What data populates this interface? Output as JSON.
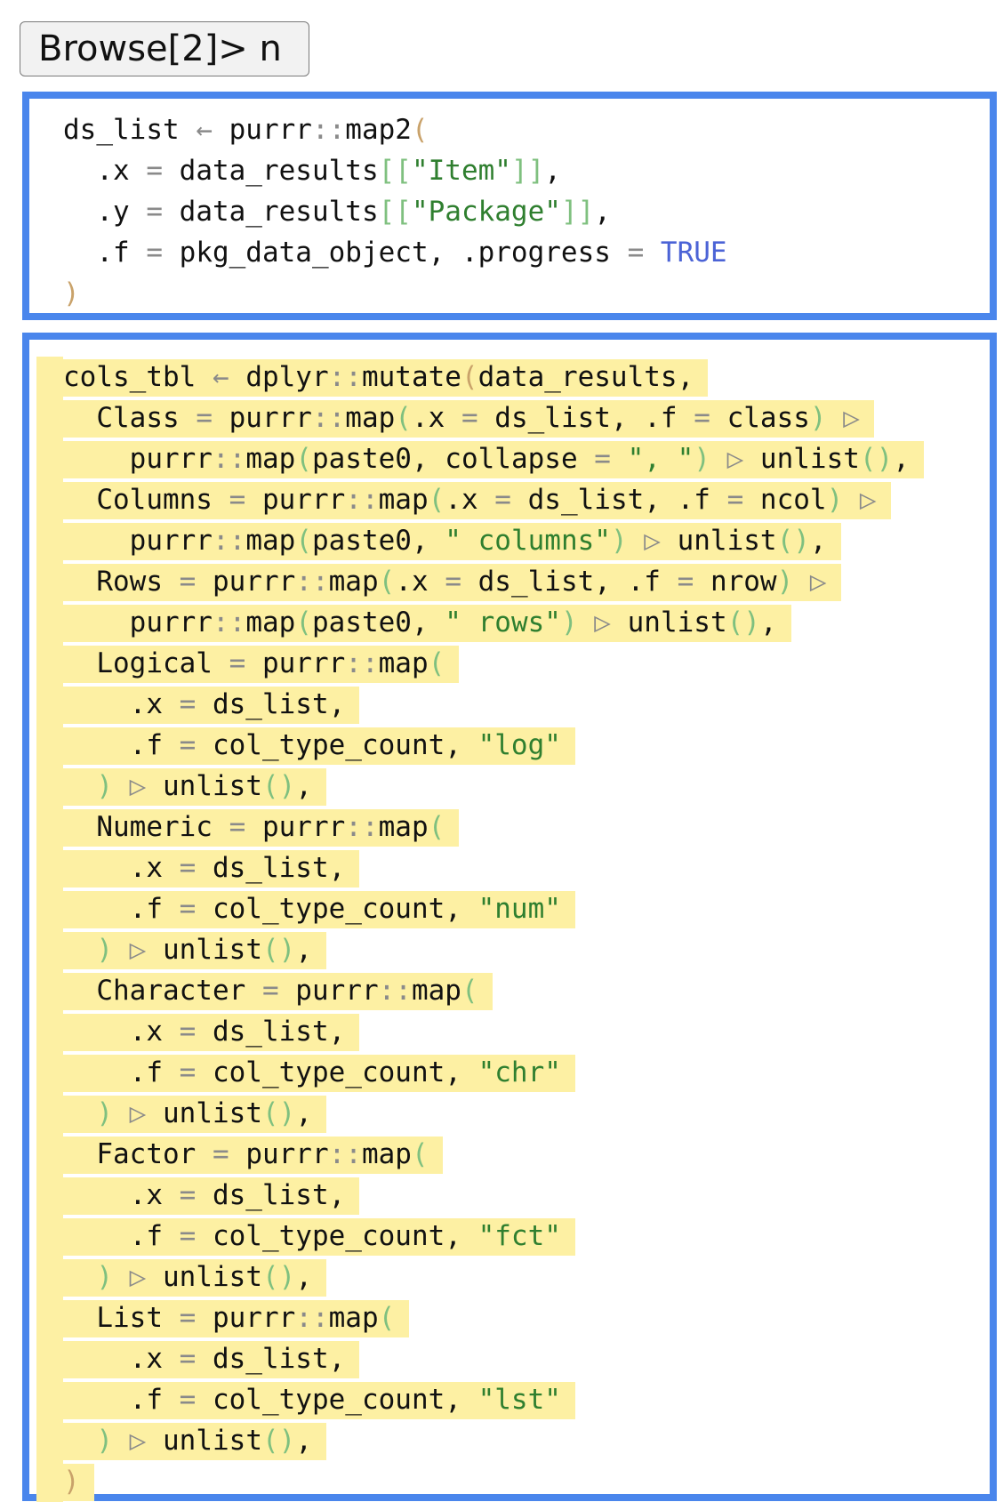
{
  "prompt": {
    "text": "Browse[2]> n"
  },
  "code_blocks": [
    {
      "highlighted": false,
      "lines": [
        [
          [
            "id",
            "ds_list "
          ],
          [
            "op",
            "← "
          ],
          [
            "id",
            "purrr"
          ],
          [
            "op",
            "::"
          ],
          [
            "id",
            "map2"
          ],
          [
            "br",
            "("
          ]
        ],
        [
          [
            "id",
            "  .x "
          ],
          [
            "op",
            "= "
          ],
          [
            "id",
            "data_results"
          ],
          [
            "br2",
            "[["
          ],
          [
            "str",
            "\"Item\""
          ],
          [
            "br2",
            "]]"
          ],
          [
            "id",
            ","
          ]
        ],
        [
          [
            "id",
            "  .y "
          ],
          [
            "op",
            "= "
          ],
          [
            "id",
            "data_results"
          ],
          [
            "br2",
            "[["
          ],
          [
            "str",
            "\"Package\""
          ],
          [
            "br2",
            "]]"
          ],
          [
            "id",
            ","
          ]
        ],
        [
          [
            "id",
            "  .f "
          ],
          [
            "op",
            "= "
          ],
          [
            "id",
            "pkg_data_object, .progress "
          ],
          [
            "op",
            "= "
          ],
          [
            "bool",
            "TRUE"
          ]
        ],
        [
          [
            "br",
            ")"
          ]
        ]
      ]
    },
    {
      "highlighted": true,
      "lines": [
        [
          [
            "id",
            "cols_tbl "
          ],
          [
            "op",
            "← "
          ],
          [
            "id",
            "dplyr"
          ],
          [
            "op",
            "::"
          ],
          [
            "id",
            "mutate"
          ],
          [
            "br",
            "("
          ],
          [
            "id",
            "data_results,"
          ]
        ],
        [
          [
            "id",
            "  Class "
          ],
          [
            "op",
            "= "
          ],
          [
            "id",
            "purrr"
          ],
          [
            "op",
            "::"
          ],
          [
            "id",
            "map"
          ],
          [
            "br2",
            "("
          ],
          [
            "id",
            ".x "
          ],
          [
            "op",
            "= "
          ],
          [
            "id",
            "ds_list, .f "
          ],
          [
            "op",
            "= "
          ],
          [
            "id",
            "class"
          ],
          [
            "br2",
            ")"
          ],
          [
            "op",
            " ▷"
          ]
        ],
        [
          [
            "id",
            "    purrr"
          ],
          [
            "op",
            "::"
          ],
          [
            "id",
            "map"
          ],
          [
            "br2",
            "("
          ],
          [
            "id",
            "paste0, collapse "
          ],
          [
            "op",
            "= "
          ],
          [
            "str",
            "\", \""
          ],
          [
            "br2",
            ")"
          ],
          [
            "op",
            " ▷ "
          ],
          [
            "id",
            "unlist"
          ],
          [
            "br2",
            "()"
          ],
          [
            "id",
            ","
          ]
        ],
        [
          [
            "id",
            "  Columns "
          ],
          [
            "op",
            "= "
          ],
          [
            "id",
            "purrr"
          ],
          [
            "op",
            "::"
          ],
          [
            "id",
            "map"
          ],
          [
            "br2",
            "("
          ],
          [
            "id",
            ".x "
          ],
          [
            "op",
            "= "
          ],
          [
            "id",
            "ds_list, .f "
          ],
          [
            "op",
            "= "
          ],
          [
            "id",
            "ncol"
          ],
          [
            "br2",
            ")"
          ],
          [
            "op",
            " ▷"
          ]
        ],
        [
          [
            "id",
            "    purrr"
          ],
          [
            "op",
            "::"
          ],
          [
            "id",
            "map"
          ],
          [
            "br2",
            "("
          ],
          [
            "id",
            "paste0, "
          ],
          [
            "str",
            "\" columns\""
          ],
          [
            "br2",
            ")"
          ],
          [
            "op",
            " ▷ "
          ],
          [
            "id",
            "unlist"
          ],
          [
            "br2",
            "()"
          ],
          [
            "id",
            ","
          ]
        ],
        [
          [
            "id",
            "  Rows "
          ],
          [
            "op",
            "= "
          ],
          [
            "id",
            "purrr"
          ],
          [
            "op",
            "::"
          ],
          [
            "id",
            "map"
          ],
          [
            "br2",
            "("
          ],
          [
            "id",
            ".x "
          ],
          [
            "op",
            "= "
          ],
          [
            "id",
            "ds_list, .f "
          ],
          [
            "op",
            "= "
          ],
          [
            "id",
            "nrow"
          ],
          [
            "br2",
            ")"
          ],
          [
            "op",
            " ▷"
          ]
        ],
        [
          [
            "id",
            "    purrr"
          ],
          [
            "op",
            "::"
          ],
          [
            "id",
            "map"
          ],
          [
            "br2",
            "("
          ],
          [
            "id",
            "paste0, "
          ],
          [
            "str",
            "\" rows\""
          ],
          [
            "br2",
            ")"
          ],
          [
            "op",
            " ▷ "
          ],
          [
            "id",
            "unlist"
          ],
          [
            "br2",
            "()"
          ],
          [
            "id",
            ","
          ]
        ],
        [
          [
            "id",
            "  Logical "
          ],
          [
            "op",
            "= "
          ],
          [
            "id",
            "purrr"
          ],
          [
            "op",
            "::"
          ],
          [
            "id",
            "map"
          ],
          [
            "br2",
            "("
          ]
        ],
        [
          [
            "id",
            "    .x "
          ],
          [
            "op",
            "= "
          ],
          [
            "id",
            "ds_list,"
          ]
        ],
        [
          [
            "id",
            "    .f "
          ],
          [
            "op",
            "= "
          ],
          [
            "id",
            "col_type_count, "
          ],
          [
            "str",
            "\"log\""
          ]
        ],
        [
          [
            "br2",
            "  )"
          ],
          [
            "op",
            " ▷ "
          ],
          [
            "id",
            "unlist"
          ],
          [
            "br2",
            "()"
          ],
          [
            "id",
            ","
          ]
        ],
        [
          [
            "id",
            "  Numeric "
          ],
          [
            "op",
            "= "
          ],
          [
            "id",
            "purrr"
          ],
          [
            "op",
            "::"
          ],
          [
            "id",
            "map"
          ],
          [
            "br2",
            "("
          ]
        ],
        [
          [
            "id",
            "    .x "
          ],
          [
            "op",
            "= "
          ],
          [
            "id",
            "ds_list,"
          ]
        ],
        [
          [
            "id",
            "    .f "
          ],
          [
            "op",
            "= "
          ],
          [
            "id",
            "col_type_count, "
          ],
          [
            "str",
            "\"num\""
          ]
        ],
        [
          [
            "br2",
            "  )"
          ],
          [
            "op",
            " ▷ "
          ],
          [
            "id",
            "unlist"
          ],
          [
            "br2",
            "()"
          ],
          [
            "id",
            ","
          ]
        ],
        [
          [
            "id",
            "  Character "
          ],
          [
            "op",
            "= "
          ],
          [
            "id",
            "purrr"
          ],
          [
            "op",
            "::"
          ],
          [
            "id",
            "map"
          ],
          [
            "br2",
            "("
          ]
        ],
        [
          [
            "id",
            "    .x "
          ],
          [
            "op",
            "= "
          ],
          [
            "id",
            "ds_list,"
          ]
        ],
        [
          [
            "id",
            "    .f "
          ],
          [
            "op",
            "= "
          ],
          [
            "id",
            "col_type_count, "
          ],
          [
            "str",
            "\"chr\""
          ]
        ],
        [
          [
            "br2",
            "  )"
          ],
          [
            "op",
            " ▷ "
          ],
          [
            "id",
            "unlist"
          ],
          [
            "br2",
            "()"
          ],
          [
            "id",
            ","
          ]
        ],
        [
          [
            "id",
            "  Factor "
          ],
          [
            "op",
            "= "
          ],
          [
            "id",
            "purrr"
          ],
          [
            "op",
            "::"
          ],
          [
            "id",
            "map"
          ],
          [
            "br2",
            "("
          ]
        ],
        [
          [
            "id",
            "    .x "
          ],
          [
            "op",
            "= "
          ],
          [
            "id",
            "ds_list,"
          ]
        ],
        [
          [
            "id",
            "    .f "
          ],
          [
            "op",
            "= "
          ],
          [
            "id",
            "col_type_count, "
          ],
          [
            "str",
            "\"fct\""
          ]
        ],
        [
          [
            "br2",
            "  )"
          ],
          [
            "op",
            " ▷ "
          ],
          [
            "id",
            "unlist"
          ],
          [
            "br2",
            "()"
          ],
          [
            "id",
            ","
          ]
        ],
        [
          [
            "id",
            "  List "
          ],
          [
            "op",
            "= "
          ],
          [
            "id",
            "purrr"
          ],
          [
            "op",
            "::"
          ],
          [
            "id",
            "map"
          ],
          [
            "br2",
            "("
          ]
        ],
        [
          [
            "id",
            "    .x "
          ],
          [
            "op",
            "= "
          ],
          [
            "id",
            "ds_list,"
          ]
        ],
        [
          [
            "id",
            "    .f "
          ],
          [
            "op",
            "= "
          ],
          [
            "id",
            "col_type_count, "
          ],
          [
            "str",
            "\"lst\""
          ]
        ],
        [
          [
            "br2",
            "  )"
          ],
          [
            "op",
            " ▷ "
          ],
          [
            "id",
            "unlist"
          ],
          [
            "br2",
            "()"
          ],
          [
            "id",
            ","
          ]
        ],
        [
          [
            "br",
            ")"
          ]
        ]
      ]
    }
  ],
  "colors": {
    "panel_border": "#4a86ec",
    "highlight": "#fdf0a3",
    "string": "#2f7f2f",
    "boolean": "#4b63d6",
    "operator": "#8a8a8a",
    "bracket_outer": "#c9a26a",
    "bracket_inner": "#7fc07f"
  }
}
